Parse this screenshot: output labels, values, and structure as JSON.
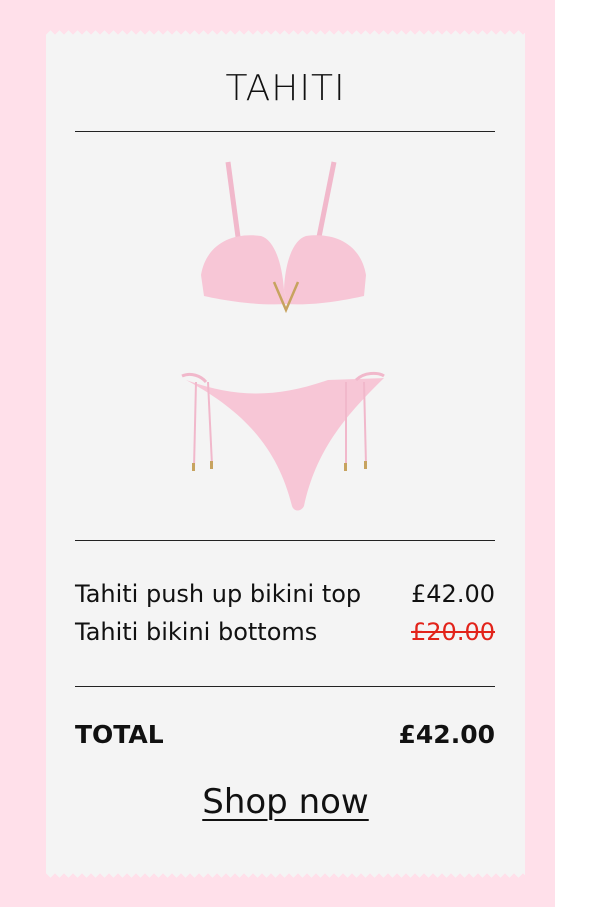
{
  "header": {
    "title": "TAHITI"
  },
  "items": [
    {
      "name": "Tahiti push up bikini top",
      "price": "£42.00",
      "strikethrough": false
    },
    {
      "name": "Tahiti bikini bottoms",
      "price": "£20.00",
      "strikethrough": true
    }
  ],
  "total": {
    "label": "TOTAL",
    "value": "£42.00"
  },
  "cta": {
    "label": "Shop now"
  },
  "colors": {
    "background": "#ffe0ea",
    "receipt": "#f4f4f4",
    "product": "#f7c6d6",
    "strike": "#e2231a"
  }
}
